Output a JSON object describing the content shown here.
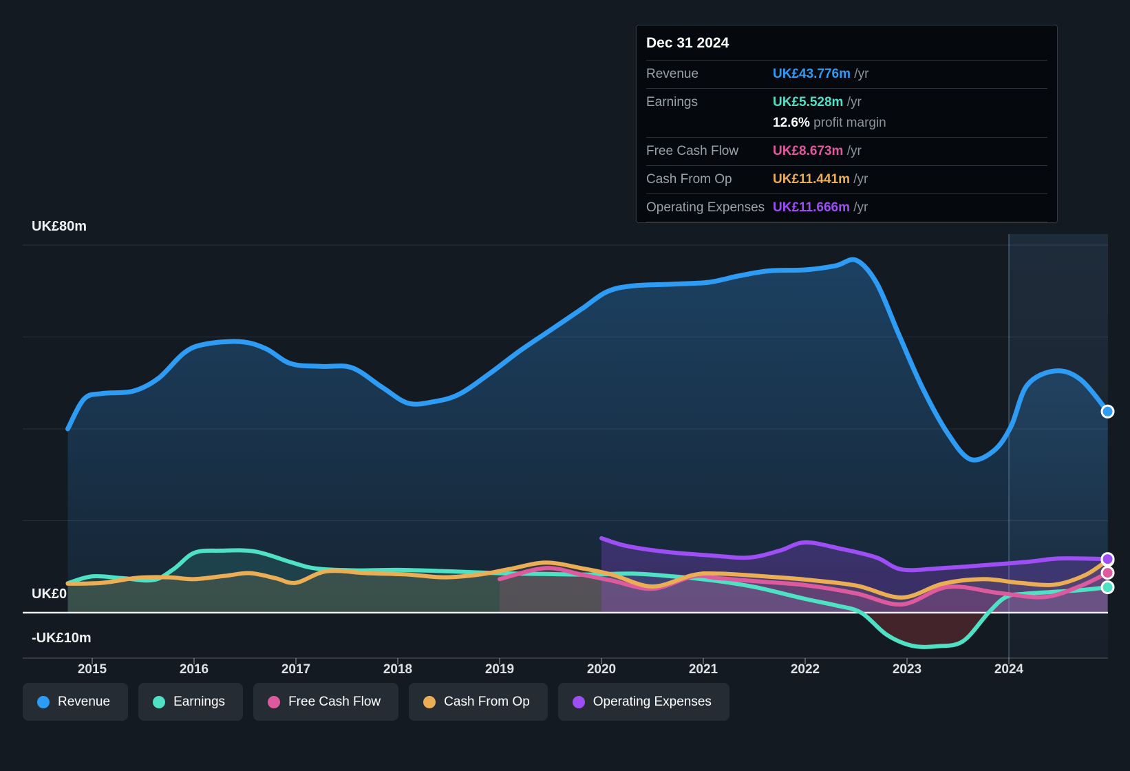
{
  "tooltip": {
    "date": "Dec 31 2024",
    "rows": [
      {
        "label": "Revenue",
        "value": "UK£43.776m",
        "suffix": " /yr",
        "color": "#2e9bf5"
      },
      {
        "label": "Earnings",
        "value": "UK£5.528m",
        "suffix": " /yr",
        "color": "#4ee1c4",
        "sub_value": "12.6%",
        "sub_text": " profit margin"
      },
      {
        "label": "Free Cash Flow",
        "value": "UK£8.673m",
        "suffix": " /yr",
        "color": "#de5a9e"
      },
      {
        "label": "Cash From Op",
        "value": "UK£11.441m",
        "suffix": " /yr",
        "color": "#ecae55"
      },
      {
        "label": "Operating Expenses",
        "value": "UK£11.666m",
        "suffix": " /yr",
        "color": "#9d4ef5"
      }
    ]
  },
  "legend": [
    {
      "label": "Revenue",
      "color": "#2e9bf5"
    },
    {
      "label": "Earnings",
      "color": "#4ee1c4"
    },
    {
      "label": "Free Cash Flow",
      "color": "#de5a9e"
    },
    {
      "label": "Cash From Op",
      "color": "#ecae55"
    },
    {
      "label": "Operating Expenses",
      "color": "#9d4ef5"
    }
  ],
  "chart_data": {
    "type": "area",
    "unit": "UK£m",
    "x_axis": {
      "ticks": [
        2015,
        2016,
        2017,
        2018,
        2019,
        2020,
        2021,
        2022,
        2023,
        2024
      ]
    },
    "y_axis": {
      "labels": [
        "UK£80m",
        "UK£0",
        "-UK£10m"
      ],
      "gridlines_m": [
        80,
        60,
        40,
        20
      ],
      "zero_m": 0,
      "bottom_m": -10,
      "range": [
        -10,
        80
      ]
    },
    "highlight_band": {
      "from_year": 2024.0,
      "to_year": 2024.97
    },
    "marker_line_year": 2024.0,
    "colors": {
      "negative_fill": "#b23b42",
      "grid": "rgba(255,255,255,0.10)",
      "zero_line": "#edf0f3",
      "axis_line": "rgba(255,255,255,0.18)"
    },
    "series": [
      {
        "name": "Revenue",
        "color": "#2e9bf5",
        "points": [
          [
            2014.76,
            40.0
          ],
          [
            2014.92,
            46.5
          ],
          [
            2015.1,
            47.7
          ],
          [
            2015.4,
            48.2
          ],
          [
            2015.65,
            51.0
          ],
          [
            2015.9,
            56.5
          ],
          [
            2016.1,
            58.4
          ],
          [
            2016.45,
            59.0
          ],
          [
            2016.7,
            57.5
          ],
          [
            2016.95,
            54.2
          ],
          [
            2017.25,
            53.6
          ],
          [
            2017.55,
            53.3
          ],
          [
            2017.85,
            49.0
          ],
          [
            2018.1,
            45.6
          ],
          [
            2018.35,
            45.9
          ],
          [
            2018.6,
            47.5
          ],
          [
            2018.9,
            52.0
          ],
          [
            2019.2,
            57.0
          ],
          [
            2019.5,
            61.5
          ],
          [
            2019.8,
            66.0
          ],
          [
            2020.05,
            69.8
          ],
          [
            2020.3,
            71.1
          ],
          [
            2020.7,
            71.5
          ],
          [
            2021.05,
            71.9
          ],
          [
            2021.35,
            73.3
          ],
          [
            2021.65,
            74.4
          ],
          [
            2022.0,
            74.6
          ],
          [
            2022.3,
            75.5
          ],
          [
            2022.5,
            76.7
          ],
          [
            2022.7,
            71.8
          ],
          [
            2022.92,
            60.5
          ],
          [
            2023.15,
            49.0
          ],
          [
            2023.4,
            39.0
          ],
          [
            2023.62,
            33.4
          ],
          [
            2023.85,
            35.2
          ],
          [
            2024.02,
            40.5
          ],
          [
            2024.18,
            49.5
          ],
          [
            2024.45,
            52.6
          ],
          [
            2024.7,
            50.8
          ],
          [
            2024.97,
            43.776
          ]
        ]
      },
      {
        "name": "Earnings",
        "color": "#4ee1c4",
        "points": [
          [
            2014.76,
            6.4
          ],
          [
            2015.0,
            7.9
          ],
          [
            2015.3,
            7.5
          ],
          [
            2015.6,
            7.1
          ],
          [
            2015.8,
            9.5
          ],
          [
            2016.0,
            13.0
          ],
          [
            2016.25,
            13.5
          ],
          [
            2016.6,
            13.3
          ],
          [
            2016.95,
            11.0
          ],
          [
            2017.2,
            9.6
          ],
          [
            2017.6,
            9.2
          ],
          [
            2018.0,
            9.3
          ],
          [
            2018.5,
            9.0
          ],
          [
            2019.0,
            8.6
          ],
          [
            2019.5,
            8.4
          ],
          [
            2019.9,
            8.3
          ],
          [
            2020.3,
            8.5
          ],
          [
            2020.7,
            7.9
          ],
          [
            2021.1,
            7.0
          ],
          [
            2021.5,
            5.6
          ],
          [
            2022.0,
            3.0
          ],
          [
            2022.3,
            1.6
          ],
          [
            2022.55,
            0.0
          ],
          [
            2022.8,
            -4.8
          ],
          [
            2023.05,
            -7.2
          ],
          [
            2023.3,
            -7.3
          ],
          [
            2023.55,
            -6.2
          ],
          [
            2023.8,
            0.0
          ],
          [
            2023.97,
            3.4
          ],
          [
            2024.15,
            4.1
          ],
          [
            2024.5,
            4.6
          ],
          [
            2024.75,
            5.0
          ],
          [
            2024.97,
            5.528
          ]
        ]
      },
      {
        "name": "Free Cash Flow",
        "color": "#de5a9e",
        "points": [
          [
            2019.0,
            7.3
          ],
          [
            2019.45,
            9.7
          ],
          [
            2019.8,
            8.3
          ],
          [
            2020.1,
            7.0
          ],
          [
            2020.5,
            5.2
          ],
          [
            2020.9,
            7.9
          ],
          [
            2021.15,
            7.5
          ],
          [
            2021.6,
            6.7
          ],
          [
            2022.0,
            6.0
          ],
          [
            2022.5,
            4.2
          ],
          [
            2022.95,
            1.8
          ],
          [
            2023.4,
            5.6
          ],
          [
            2023.9,
            4.3
          ],
          [
            2024.35,
            3.4
          ],
          [
            2024.7,
            5.8
          ],
          [
            2024.97,
            8.673
          ]
        ]
      },
      {
        "name": "Cash From Op",
        "color": "#ecae55",
        "points": [
          [
            2014.76,
            6.3
          ],
          [
            2015.1,
            6.5
          ],
          [
            2015.45,
            7.6
          ],
          [
            2015.75,
            7.7
          ],
          [
            2016.0,
            7.3
          ],
          [
            2016.3,
            8.0
          ],
          [
            2016.55,
            8.6
          ],
          [
            2016.8,
            7.5
          ],
          [
            2017.0,
            6.5
          ],
          [
            2017.3,
            9.0
          ],
          [
            2017.7,
            8.6
          ],
          [
            2018.1,
            8.3
          ],
          [
            2018.45,
            7.7
          ],
          [
            2018.8,
            8.3
          ],
          [
            2019.1,
            9.5
          ],
          [
            2019.45,
            10.9
          ],
          [
            2019.8,
            9.7
          ],
          [
            2020.1,
            8.3
          ],
          [
            2020.5,
            5.7
          ],
          [
            2020.9,
            8.2
          ],
          [
            2021.15,
            8.5
          ],
          [
            2021.6,
            7.9
          ],
          [
            2022.0,
            7.2
          ],
          [
            2022.5,
            5.9
          ],
          [
            2022.95,
            3.3
          ],
          [
            2023.35,
            6.3
          ],
          [
            2023.75,
            7.3
          ],
          [
            2024.1,
            6.5
          ],
          [
            2024.45,
            6.1
          ],
          [
            2024.75,
            8.2
          ],
          [
            2024.97,
            11.441
          ]
        ]
      },
      {
        "name": "Operating Expenses",
        "color": "#9d4ef5",
        "points": [
          [
            2020.0,
            16.2
          ],
          [
            2020.25,
            14.5
          ],
          [
            2020.65,
            13.2
          ],
          [
            2021.1,
            12.4
          ],
          [
            2021.45,
            12.0
          ],
          [
            2021.75,
            13.5
          ],
          [
            2022.0,
            15.3
          ],
          [
            2022.35,
            13.9
          ],
          [
            2022.7,
            12.0
          ],
          [
            2022.95,
            9.4
          ],
          [
            2023.35,
            9.7
          ],
          [
            2023.8,
            10.4
          ],
          [
            2024.2,
            11.1
          ],
          [
            2024.5,
            11.8
          ],
          [
            2024.97,
            11.666
          ]
        ]
      }
    ]
  }
}
